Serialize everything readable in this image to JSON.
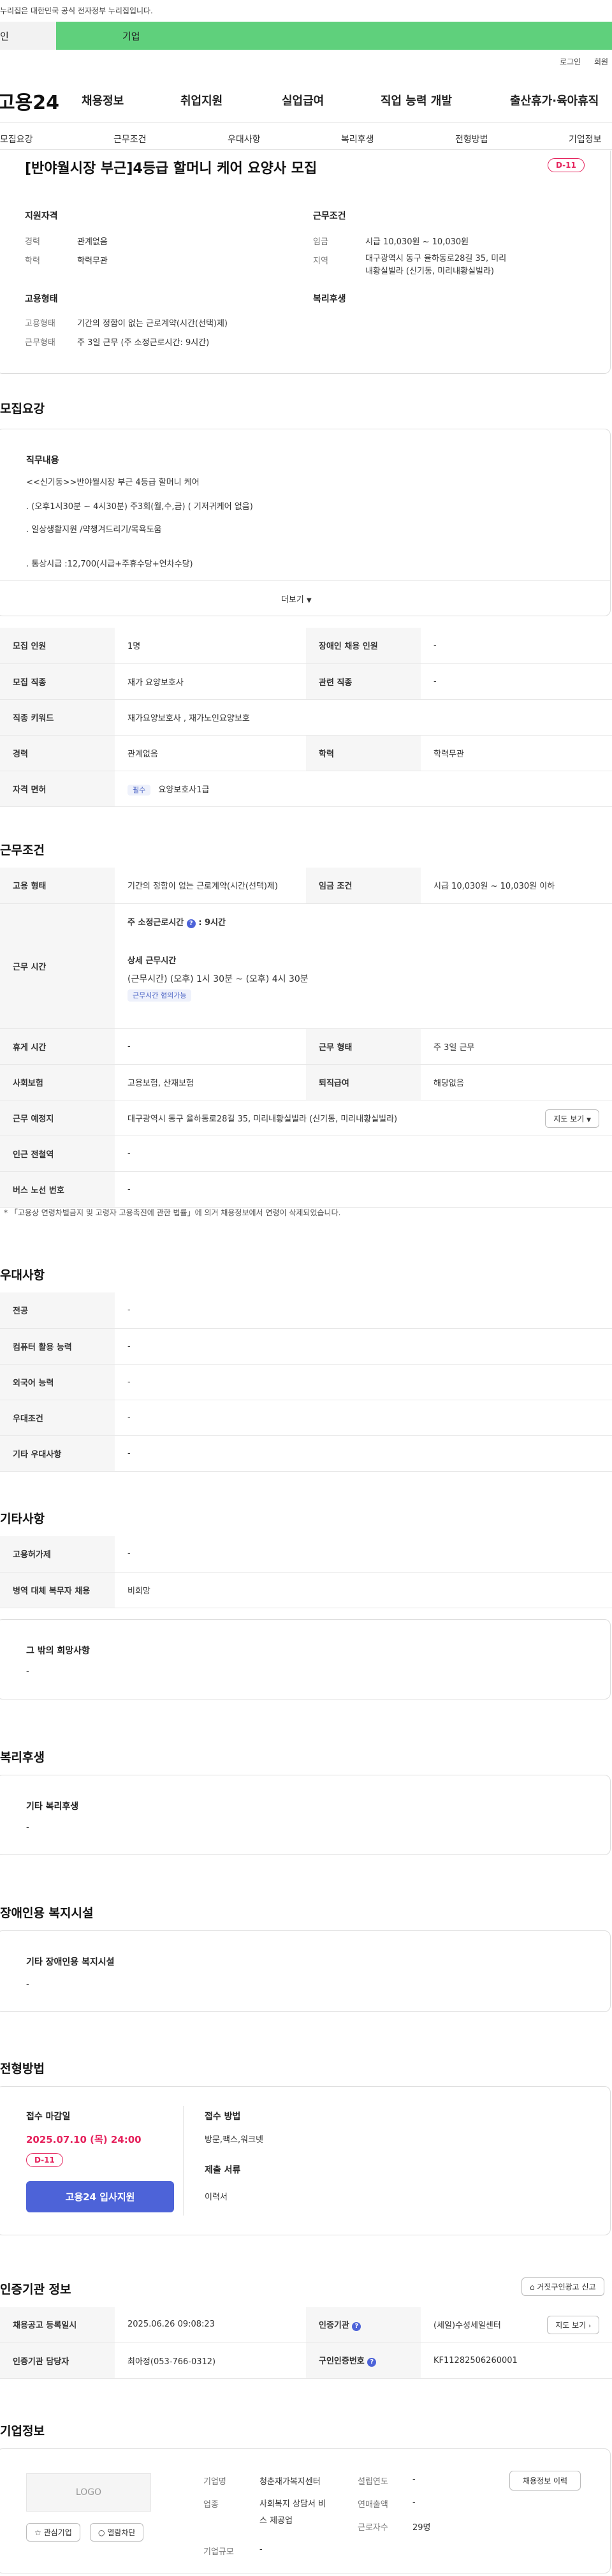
{
  "gov_notice": "누리집은 대한민국 공식 전자정부 누리집입니다.",
  "tabs": {
    "individual": "인",
    "company": "기업"
  },
  "util": {
    "login": "로그인",
    "join": "회원"
  },
  "gnb": {
    "logo": "고용24",
    "items": [
      "채용정보",
      "취업지원",
      "실업급여",
      "직업 능력 개발",
      "출산휴가·육아휴직"
    ]
  },
  "subnav": [
    "모집요강",
    "근무조건",
    "우대사항",
    "복리후생",
    "전형방법",
    "기업정보"
  ],
  "job": {
    "title": "[반야월시장 부근]4등급 할머니 케어 요양사 모집",
    "dday": "D-11",
    "qual_title": "지원자격",
    "qual": [
      {
        "label": "경력",
        "value": "관계없음"
      },
      {
        "label": "학력",
        "value": "학력무관"
      }
    ],
    "cond_title": "근무조건",
    "cond": [
      {
        "label": "임금",
        "value": "시급 10,030원 ~ 10,030원"
      },
      {
        "label": "지역",
        "value": "대구광역시 동구 율하동로28길 35, 미리내황실빌라 (신기동, 미리내황실빌라)"
      }
    ],
    "emp_title": "고용형태",
    "emp": [
      {
        "label": "고용형태",
        "value": "기간의 정함이 없는 근로계약(시간(선택)제)"
      },
      {
        "label": "근무형태",
        "value": "주 3일 근무 (주 소정근로시간: 9시간)"
      }
    ],
    "welfare_title": "복리후생"
  },
  "recruit": {
    "section_title": "모집요강",
    "duty_title": "직무내용",
    "duty_lines": [
      "<<신기동>>반야월시장 부근  4등급 할머니 케어",
      ". (오후1시30분 ~ 4시30분)  주3회(월,수,금) ( 기저귀케어 없음)",
      ".  일상생활지원 /약챙겨드리기/목욕도움",
      ". 통상시급 :12,700(시급+주휴수당+연차수당)"
    ],
    "more": "더보기",
    "table": [
      [
        "모집 인원",
        "1명",
        "장애인 채용 인원",
        "-"
      ],
      [
        "모집 직종",
        "재가 요양보호사",
        "관련 직종",
        "-"
      ],
      [
        "직종 키워드",
        "재가요양보호사 , 재가노인요양보호",
        "",
        ""
      ],
      [
        "경력",
        "관계없음",
        "학력",
        "학력무관"
      ],
      [
        "자격 면허",
        "요양보호사1급",
        "",
        ""
      ]
    ],
    "cert_chip": "필수"
  },
  "work": {
    "section_title": "근무조건",
    "emp_type_label": "고용 형태",
    "emp_type_value": "기간의 정함이 없는 근로계약(시간(선택)제)",
    "wage_label": "임금 조건",
    "wage_value": "시급 10,030원 ~ 10,030원 이하",
    "hours_label": "근무 시간",
    "hours_weekly": "주 소정근로시간",
    "hours_weekly_val": ": 9시간",
    "hours_detail_title": "상세 근무시간",
    "hours_detail": "(근무시간) (오후) 1시 30분 ~ (오후) 4시 30분",
    "hours_chip": "근무시간 협의가능",
    "rest_label": "휴게 시간",
    "rest_value": "-",
    "worktype_label": "근무 형태",
    "worktype_value": "주 3일 근무",
    "insurance_label": "사회보험",
    "insurance_value": "고용보험, 산재보험",
    "retire_label": "퇴직급여",
    "retire_value": "해당없음",
    "place_label": "근무 예정지",
    "place_value": "대구광역시 동구 율하동로28길 35, 미리내황실빌라 (신기동, 미리내황실빌라)",
    "map_btn": "지도 보기",
    "station_label": "인근 전철역",
    "station_value": "-",
    "bus_label": "버스 노선 번호",
    "bus_value": "-",
    "note": "「고용상 연령차별금지 및 고령자 고용촉진에 관한 법률」에 의거 채용정보에서 연령이 삭제되었습니다."
  },
  "prefer": {
    "section_title": "우대사항",
    "rows": [
      [
        "전공",
        "-"
      ],
      [
        "컴퓨터 활용 능력",
        "-"
      ],
      [
        "외국어 능력",
        "-"
      ],
      [
        "우대조건",
        "-"
      ],
      [
        "기타 우대사항",
        "-"
      ]
    ]
  },
  "etc": {
    "section_title": "기타사항",
    "rows": [
      [
        "고용허가제",
        "-"
      ],
      [
        "병역 대체 복무자 채용",
        "비희망"
      ]
    ],
    "other_title": "그 밖의 희망사항",
    "other_value": "-"
  },
  "welfare": {
    "section_title": "복리후생",
    "box_title": "기타 복리후생",
    "box_value": "-"
  },
  "disabled": {
    "section_title": "장애인용 복지시설",
    "box_title": "기타 장애인용 복지시설",
    "box_value": "-"
  },
  "screening": {
    "section_title": "전형방법",
    "deadline_title": "접수 마감일",
    "deadline": "2025.07.10 (목) 24:00",
    "dday": "D-11",
    "apply_btn": "고용24 입사지원",
    "method_title": "접수 방법",
    "method_value": "방문,팩스,워크넷",
    "docs_title": "제출 서류",
    "docs_value": "이력서"
  },
  "agency": {
    "section_title": "인증기관 정보",
    "report_btn": "거짓구인광고 신고",
    "reg_label": "채용공고 등록일시",
    "reg_value": "2025.06.26 09:08:23",
    "agency_label": "인증기관",
    "agency_value": "(세일)수성세일센터",
    "map_btn": "지도 보기",
    "manager_label": "인증기관 담당자",
    "manager_value": "최아정(053-766-0312)",
    "num_label": "구인인증번호",
    "num_value": "KF11282506260001"
  },
  "company": {
    "section_title": "기업정보",
    "logo_text": "LOGO",
    "fav_btn": "관심기업",
    "block_btn": "열람차단",
    "name_label": "기업명",
    "name_value": "청춘재가복지센터",
    "industry_label": "업종",
    "industry_value": "사회복지 상담서 비스 제공업",
    "size_label": "기업규모",
    "size_value": "-",
    "founded_label": "설립연도",
    "founded_value": "-",
    "revenue_label": "연매출액",
    "revenue_value": "-",
    "staff_label": "근로자수",
    "staff_value": "29명",
    "history_btn": "채용정보 이력"
  },
  "colors": {
    "green": "#5fd07c",
    "accent": "#e5225c",
    "blue": "#4d63d8"
  }
}
